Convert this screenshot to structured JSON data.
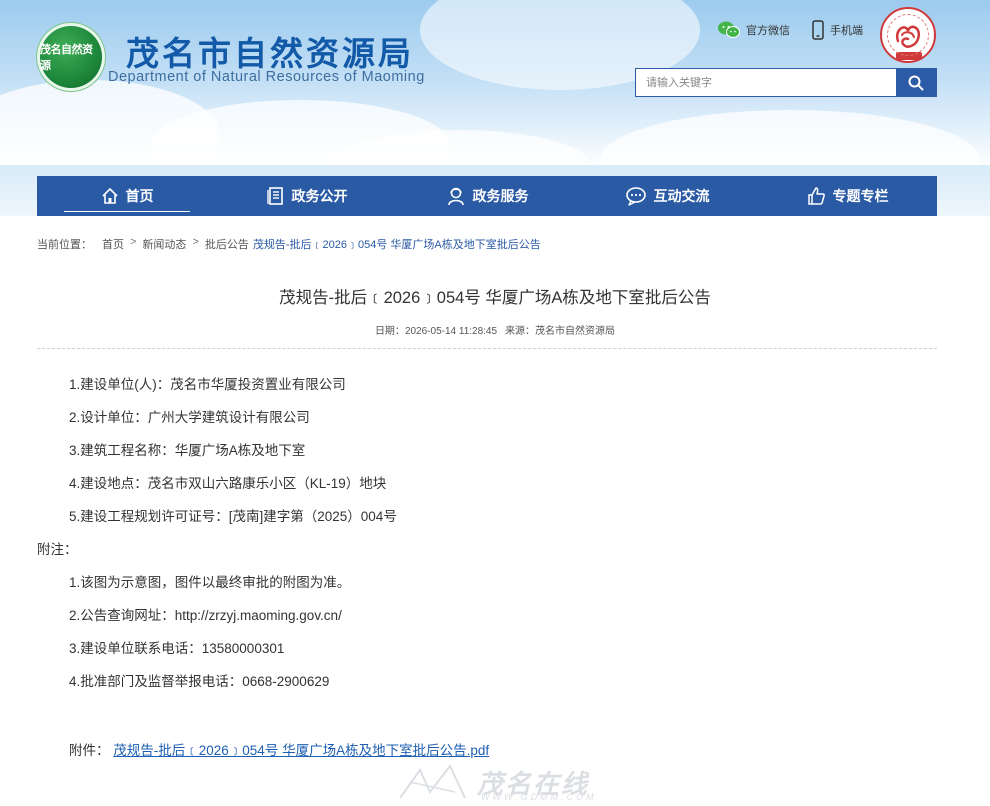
{
  "header": {
    "logo_text": "茂名自然资源",
    "site_title": "茂名市自然资源局",
    "site_subtitle": "Department of Natural Resources of Maoming",
    "links": [
      {
        "label": "官方微信",
        "icon": "wechat-icon"
      },
      {
        "label": "手机端",
        "icon": "mobile-phone-icon"
      }
    ],
    "seal_text": "MAOMING",
    "search": {
      "placeholder": "请输入关键字",
      "icon": "search-icon"
    }
  },
  "nav": {
    "items": [
      {
        "label": "首页",
        "icon": "home-icon",
        "active": true
      },
      {
        "label": "政务公开",
        "icon": "document-icon"
      },
      {
        "label": "政务服务",
        "icon": "service-person-icon"
      },
      {
        "label": "互动交流",
        "icon": "chat-icon"
      },
      {
        "label": "专题专栏",
        "icon": "thumbs-up-icon"
      }
    ]
  },
  "breadcrumb": {
    "label": "当前位置：",
    "items": [
      "首页",
      "新闻动态",
      "批后公告"
    ],
    "current": "茂规告-批后﹝2026﹞054号 华厦广场A栋及地下室批后公告"
  },
  "article": {
    "title": "茂规告-批后﹝2026﹞054号 华厦广场A栋及地下室批后公告",
    "date_label": "日期：",
    "date": "2026-05-14 11:28:45",
    "source_label": "来源：",
    "source": "茂名市自然资源局",
    "lines": [
      "1.建设单位(人)：茂名市华厦投资置业有限公司",
      "2.设计单位：广州大学建筑设计有限公司",
      "3.建筑工程名称：华厦广场A栋及地下室",
      "4.建设地点：茂名市双山六路康乐小区（KL-19）地块",
      "5.建设工程规划许可证号：[茂南]建字第（2025）004号"
    ],
    "notes_label": "附注：",
    "notes": [
      "1.该图为示意图，图件以最终审批的附图为准。",
      "2.公告查询网址：http://zrzyj.maoming.gov.cn/",
      "3.建设单位联系电话：13580000301",
      "4.批准部门及监督举报电话：0668-2900629"
    ],
    "attachment_label": "附件：",
    "attachment_file": "茂规告-批后﹝2026﹞054号 华厦广场A栋及地下室批后公告.pdf"
  },
  "watermark": {
    "text": "茂名在线",
    "url": "WWW.GDMM.COM"
  }
}
